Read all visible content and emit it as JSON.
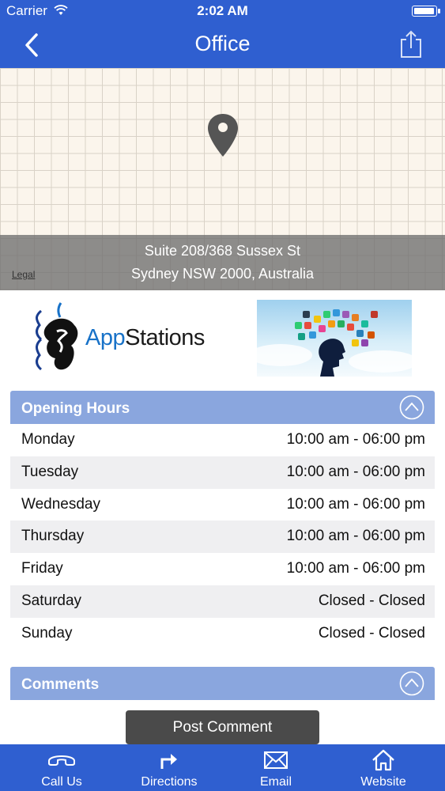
{
  "status": {
    "carrier": "Carrier",
    "time": "2:02 AM"
  },
  "nav": {
    "title": "Office"
  },
  "map": {
    "address_line1": "Suite 208/368 Sussex St",
    "address_line2": "Sydney NSW 2000, Australia",
    "legal": "Legal"
  },
  "logos": {
    "brand_a": "App",
    "brand_b": "Stations"
  },
  "hours": {
    "header": "Opening Hours",
    "rows": [
      {
        "day": "Monday",
        "time": "10:00 am - 06:00 pm"
      },
      {
        "day": "Tuesday",
        "time": "10:00 am - 06:00 pm"
      },
      {
        "day": "Wednesday",
        "time": "10:00 am - 06:00 pm"
      },
      {
        "day": "Thursday",
        "time": "10:00 am - 06:00 pm"
      },
      {
        "day": "Friday",
        "time": "10:00 am - 06:00 pm"
      },
      {
        "day": "Saturday",
        "time": "Closed - Closed"
      },
      {
        "day": "Sunday",
        "time": "Closed - Closed"
      }
    ]
  },
  "comments": {
    "header": "Comments",
    "post_label": "Post Comment"
  },
  "tabs": [
    {
      "label": "Call Us",
      "icon": "phone-icon"
    },
    {
      "label": "Directions",
      "icon": "directions-icon"
    },
    {
      "label": "Email",
      "icon": "mail-icon"
    },
    {
      "label": "Website",
      "icon": "home-icon"
    }
  ],
  "colors": {
    "nav_blue": "#2f5fd0",
    "section_header": "#8aa6de",
    "alt_row": "#efeff1",
    "post_button": "#4a4a4a"
  }
}
